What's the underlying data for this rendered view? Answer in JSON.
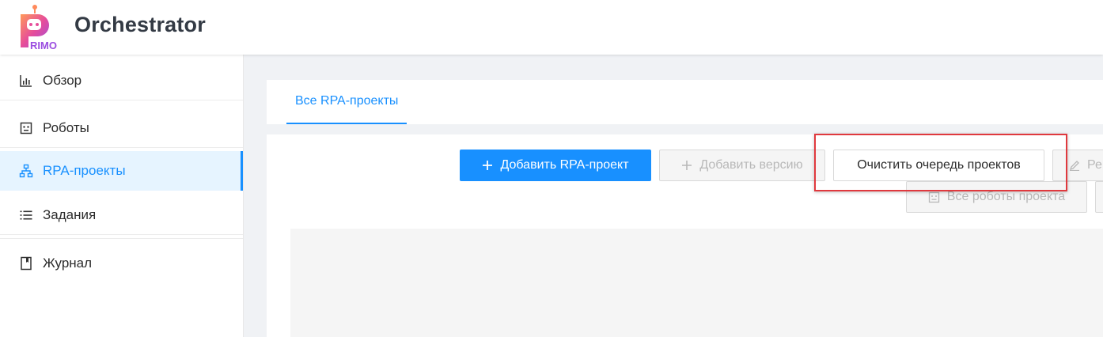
{
  "header": {
    "logo_text": "RIMO",
    "app_title": "Orchestrator"
  },
  "sidebar": {
    "items": [
      {
        "label": "Обзор",
        "icon": "bar-chart-icon"
      },
      {
        "label": "Роботы",
        "icon": "robot-icon"
      },
      {
        "label": "RPA-проекты",
        "icon": "org-tree-icon",
        "active": true
      },
      {
        "label": "Задания",
        "icon": "list-icon"
      },
      {
        "label": "Журнал",
        "icon": "book-icon"
      }
    ]
  },
  "main": {
    "tab_label": "Все RPA-проекты",
    "buttons": {
      "add_project": "Добавить RPA-проект",
      "add_version": "Добавить версию",
      "clear_queue": "Очистить очередь проектов",
      "edit_partial": "Ре",
      "all_robots": "Все роботы проекта"
    }
  },
  "colors": {
    "accent": "#1890ff",
    "highlight": "#e0393e",
    "active_bg": "#e6f4ff"
  }
}
